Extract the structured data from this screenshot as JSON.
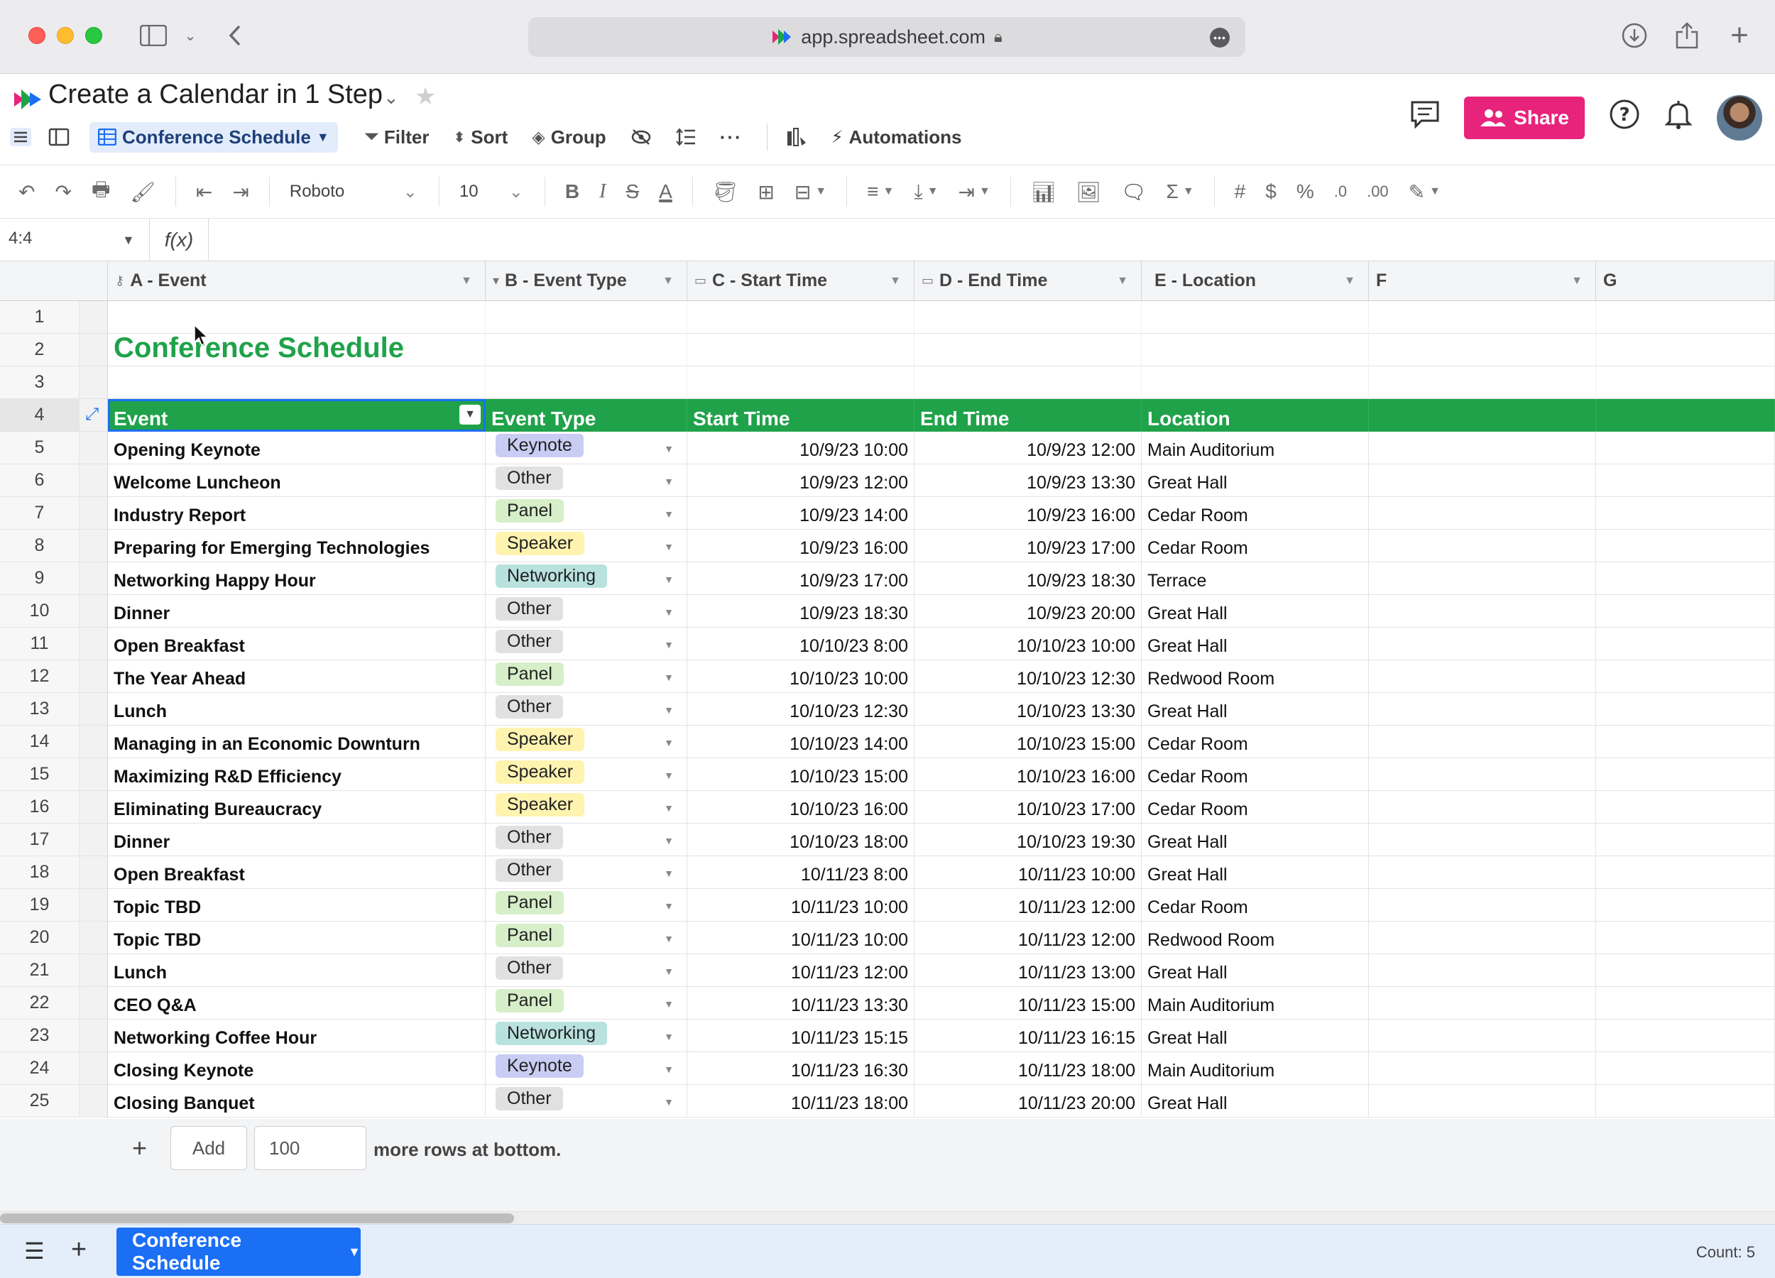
{
  "browser": {
    "url": "app.spreadsheet.com"
  },
  "doc": {
    "title": "Create a Calendar in 1 Step"
  },
  "viewbar": {
    "view_name": "Conference Schedule",
    "filter": "Filter",
    "sort": "Sort",
    "group": "Group",
    "automations": "Automations"
  },
  "header": {
    "share": "Share"
  },
  "format": {
    "font": "Roboto",
    "size": "10"
  },
  "formula": {
    "cellref": "4:4",
    "fx": "f(x)"
  },
  "columns": [
    {
      "label": "A - Event"
    },
    {
      "label": "B - Event Type"
    },
    {
      "label": "C - Start Time"
    },
    {
      "label": "D - End Time"
    },
    {
      "label": "E - Location"
    },
    {
      "label": "F"
    },
    {
      "label": "G"
    }
  ],
  "sheet_title": "Conference Schedule",
  "table_headers": [
    "Event",
    "Event Type",
    "Start Time",
    "End Time",
    "Location"
  ],
  "type_colors": {
    "Keynote": "#c9cdf3",
    "Other": "#e1e1e1",
    "Panel": "#d6efc9",
    "Speaker": "#fff3b0",
    "Networking": "#b9e2df"
  },
  "rows": [
    {
      "event": "Opening Keynote",
      "type": "Keynote",
      "start": "10/9/23 10:00",
      "end": "10/9/23 12:00",
      "location": "Main Auditorium"
    },
    {
      "event": "Welcome Luncheon",
      "type": "Other",
      "start": "10/9/23 12:00",
      "end": "10/9/23 13:30",
      "location": "Great Hall"
    },
    {
      "event": "Industry Report",
      "type": "Panel",
      "start": "10/9/23 14:00",
      "end": "10/9/23 16:00",
      "location": "Cedar Room"
    },
    {
      "event": "Preparing for Emerging Technologies",
      "type": "Speaker",
      "start": "10/9/23 16:00",
      "end": "10/9/23 17:00",
      "location": "Cedar Room"
    },
    {
      "event": "Networking Happy Hour",
      "type": "Networking",
      "start": "10/9/23 17:00",
      "end": "10/9/23 18:30",
      "location": "Terrace"
    },
    {
      "event": "Dinner",
      "type": "Other",
      "start": "10/9/23 18:30",
      "end": "10/9/23 20:00",
      "location": "Great Hall"
    },
    {
      "event": "Open Breakfast",
      "type": "Other",
      "start": "10/10/23 8:00",
      "end": "10/10/23 10:00",
      "location": "Great Hall"
    },
    {
      "event": "The Year Ahead",
      "type": "Panel",
      "start": "10/10/23 10:00",
      "end": "10/10/23 12:30",
      "location": "Redwood Room"
    },
    {
      "event": "Lunch",
      "type": "Other",
      "start": "10/10/23 12:30",
      "end": "10/10/23 13:30",
      "location": "Great Hall"
    },
    {
      "event": "Managing in an Economic Downturn",
      "type": "Speaker",
      "start": "10/10/23 14:00",
      "end": "10/10/23 15:00",
      "location": "Cedar Room"
    },
    {
      "event": "Maximizing R&D Efficiency",
      "type": "Speaker",
      "start": "10/10/23 15:00",
      "end": "10/10/23 16:00",
      "location": "Cedar Room"
    },
    {
      "event": "Eliminating Bureaucracy",
      "type": "Speaker",
      "start": "10/10/23 16:00",
      "end": "10/10/23 17:00",
      "location": "Cedar Room"
    },
    {
      "event": "Dinner",
      "type": "Other",
      "start": "10/10/23 18:00",
      "end": "10/10/23 19:30",
      "location": "Great Hall"
    },
    {
      "event": "Open Breakfast",
      "type": "Other",
      "start": "10/11/23 8:00",
      "end": "10/11/23 10:00",
      "location": "Great Hall"
    },
    {
      "event": "Topic TBD",
      "type": "Panel",
      "start": "10/11/23 10:00",
      "end": "10/11/23 12:00",
      "location": "Cedar Room"
    },
    {
      "event": "Topic TBD",
      "type": "Panel",
      "start": "10/11/23 10:00",
      "end": "10/11/23 12:00",
      "location": "Redwood Room"
    },
    {
      "event": "Lunch",
      "type": "Other",
      "start": "10/11/23 12:00",
      "end": "10/11/23 13:00",
      "location": "Great Hall"
    },
    {
      "event": "CEO Q&A",
      "type": "Panel",
      "start": "10/11/23 13:30",
      "end": "10/11/23 15:00",
      "location": "Main Auditorium"
    },
    {
      "event": "Networking Coffee Hour",
      "type": "Networking",
      "start": "10/11/23 15:15",
      "end": "10/11/23 16:15",
      "location": "Great Hall"
    },
    {
      "event": "Closing Keynote",
      "type": "Keynote",
      "start": "10/11/23 16:30",
      "end": "10/11/23 18:00",
      "location": "Main Auditorium"
    },
    {
      "event": "Closing Banquet",
      "type": "Other",
      "start": "10/11/23 18:00",
      "end": "10/11/23 20:00",
      "location": "Great Hall"
    }
  ],
  "bottom": {
    "add_label": "Add",
    "add_count": "100",
    "add_suffix": "more rows at bottom."
  },
  "sheet_tab": "Conference Schedule",
  "status": {
    "count": "Count: 5"
  },
  "accent": {
    "green": "#1fa24a",
    "share": "#e8237c",
    "tab": "#1b6ff5"
  }
}
